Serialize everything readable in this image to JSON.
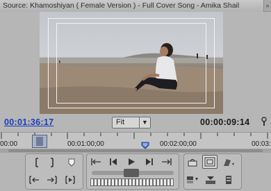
{
  "tab": {
    "title": "Source: Khamoshiyan ( Female Version ) - Full Cover Song - Amika Shail"
  },
  "timecodes": {
    "current": "00:01:36:17",
    "duration": "00:00:09:14"
  },
  "zoom": {
    "selected": "Fit"
  },
  "ruler": {
    "labels": [
      "00:00",
      "00:01:00;00",
      "00:02:00;00",
      "00:03:"
    ]
  },
  "icons": {
    "tab_close": "close-icon",
    "settings": "wrench-icon",
    "dropdown": "chevron-down-icon"
  }
}
